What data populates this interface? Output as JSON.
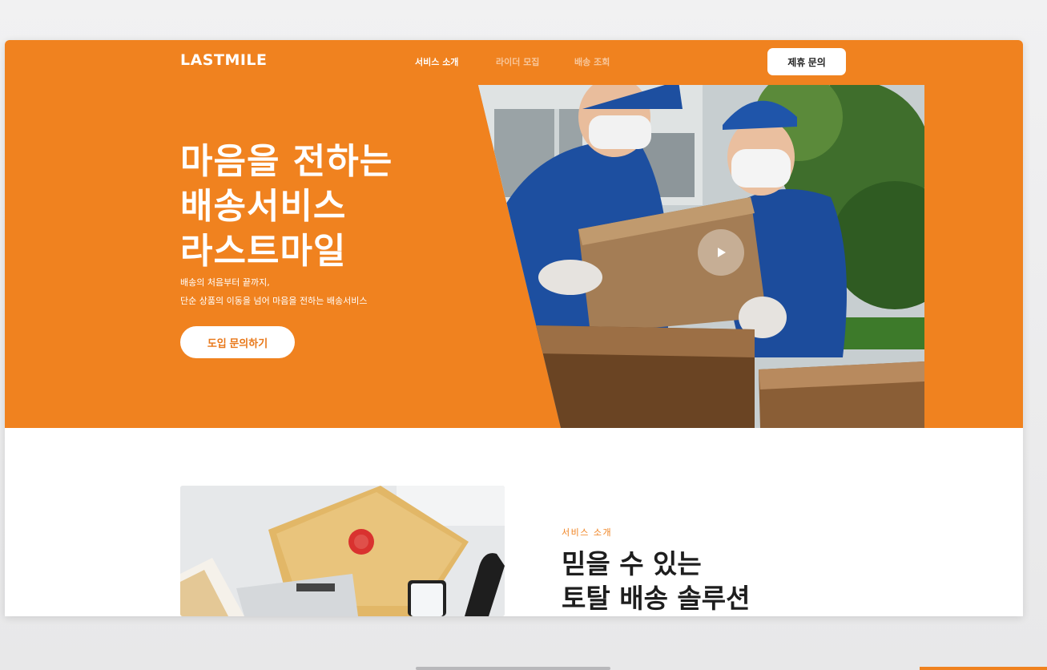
{
  "brand": {
    "logo": "LASTMILE",
    "accent_color": "#f0821f"
  },
  "nav": {
    "links": [
      {
        "label": "서비스 소개",
        "active": true
      },
      {
        "label": "라이더 모집",
        "active": false
      },
      {
        "label": "배송 조회",
        "active": false
      }
    ],
    "contact_button": "제휴 문의"
  },
  "hero": {
    "title_lines": [
      "마음을 전하는",
      "배송서비스",
      "라스트마일"
    ],
    "description_lines": [
      "배송의 처음부터 끝까지,",
      "단순 상품의 이동을 넘어 마음을 전하는 배송서비스"
    ],
    "cta_button": "도입 문의하기",
    "video_icon": "play-icon"
  },
  "service": {
    "eyebrow": "서비스 소개",
    "title_lines": [
      "믿을 수 있는",
      "토탈 배송 솔루션"
    ]
  }
}
